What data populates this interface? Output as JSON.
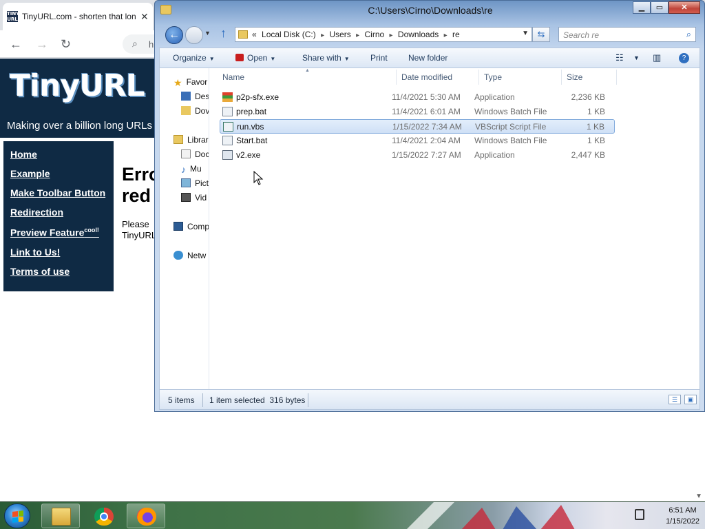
{
  "browser": {
    "tab_title": "TinyURL.com - shorten that lon",
    "tab_close": "✕",
    "favicon_text": "TINY URL",
    "omnibox_text": "h"
  },
  "tinyurl": {
    "logo": "TinyURL",
    "tagline": "Making over a billion long URLs",
    "links": [
      "Home",
      "Example",
      "Make Toolbar Button",
      "Redirection",
      "Preview Feature",
      "Link to Us!",
      "Terms of use"
    ],
    "cool_sup": "cool!",
    "error_heading": "Erro red",
    "please_text": "Please TinyURL"
  },
  "explorer": {
    "title": "C:\\Users\\Cirno\\Downloads\\re",
    "address": {
      "overflow": "«",
      "crumbs": [
        "Local Disk (C:)",
        "Users",
        "Cirno",
        "Downloads",
        "re"
      ]
    },
    "search_placeholder": "Search re",
    "commands": {
      "organize": "Organize",
      "open": "Open",
      "share_with": "Share with",
      "print": "Print",
      "new_folder": "New folder"
    },
    "nav": [
      "Favor",
      "Des",
      "Dov",
      "Librar",
      "Doc",
      "Mu",
      "Pict",
      "Vid",
      "Comp",
      "Netw"
    ],
    "columns": {
      "name": "Name",
      "date": "Date modified",
      "type": "Type",
      "size": "Size"
    },
    "files": [
      {
        "name": "p2p-sfx.exe",
        "date": "11/4/2021 5:30 AM",
        "type": "Application",
        "size": "2,236 KB",
        "icon": "installer-icon",
        "selected": false
      },
      {
        "name": "prep.bat",
        "date": "11/4/2021 6:01 AM",
        "type": "Windows Batch File",
        "size": "1 KB",
        "icon": "batch-file-icon",
        "selected": false
      },
      {
        "name": "run.vbs",
        "date": "1/15/2022 7:34 AM",
        "type": "VBScript Script File",
        "size": "1 KB",
        "icon": "script-file-icon",
        "selected": true
      },
      {
        "name": "Start.bat",
        "date": "11/4/2021 2:04 AM",
        "type": "Windows Batch File",
        "size": "1 KB",
        "icon": "batch-file-icon",
        "selected": false
      },
      {
        "name": "v2.exe",
        "date": "1/15/2022 7:27 AM",
        "type": "Application",
        "size": "2,447 KB",
        "icon": "application-icon",
        "selected": false
      }
    ],
    "status": {
      "items_count": "5 items",
      "selection": "1 item selected  316 bytes"
    },
    "colors": {
      "selection_bg": "#cfe0f6",
      "selection_border": "#84acdd",
      "close_button": "#c0453a"
    }
  },
  "taskbar": {
    "time": "6:51 AM",
    "date": "1/15/2022",
    "pinned": [
      "file-explorer-icon",
      "chrome-icon",
      "firefox-icon"
    ]
  }
}
